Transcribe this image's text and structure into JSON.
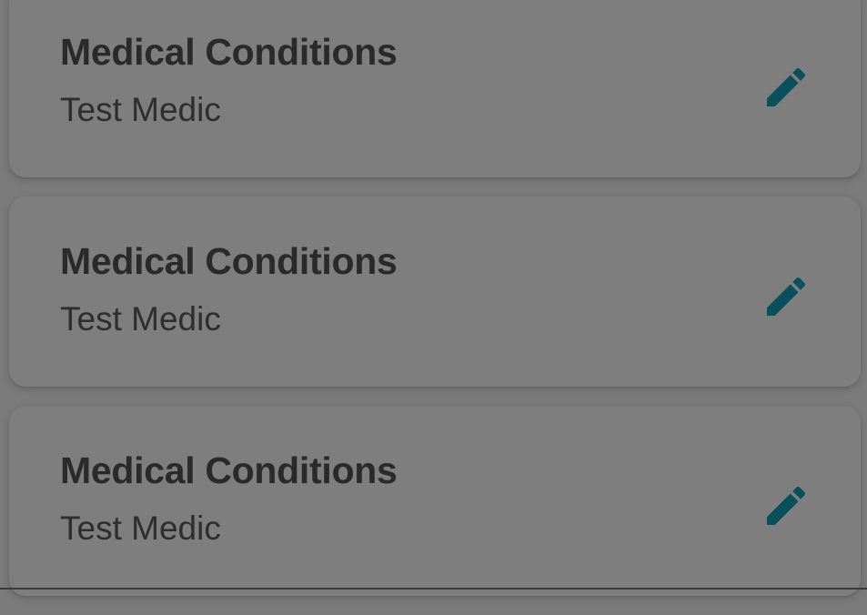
{
  "colors": {
    "background": "#7b7b7b",
    "card": "#7e7e7e",
    "title": "#2a2a2a",
    "value": "#2e2e2e",
    "edit_icon": "#0a4f5c"
  },
  "cards": [
    {
      "title": "Medical Conditions",
      "value": "Test Medic",
      "action_icon": "pencil-icon"
    },
    {
      "title": "Medical Conditions",
      "value": "Test Medic",
      "action_icon": "pencil-icon"
    },
    {
      "title": "Medical Conditions",
      "value": "Test Medic",
      "action_icon": "pencil-icon"
    }
  ]
}
